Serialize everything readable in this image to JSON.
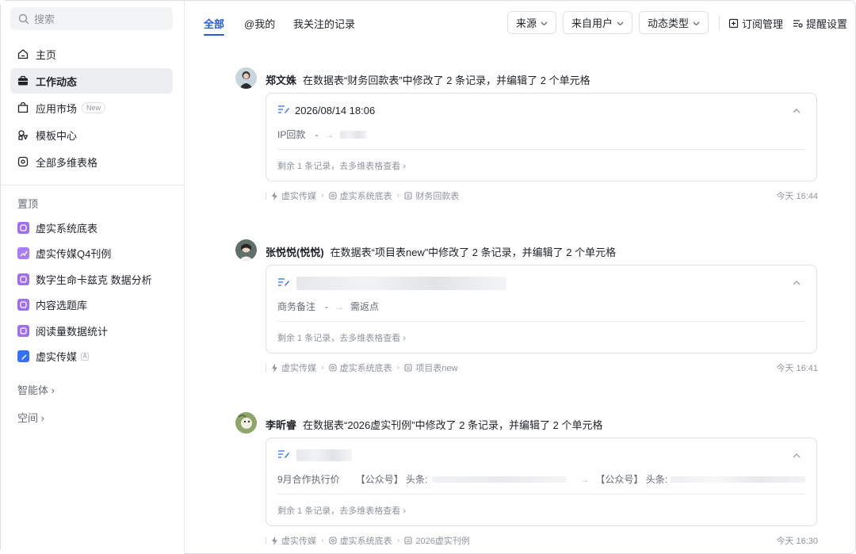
{
  "search": {
    "placeholder": "搜索"
  },
  "nav": [
    {
      "label": "主页",
      "icon": "home-icon"
    },
    {
      "label": "工作动态",
      "icon": "briefcase-icon",
      "active": true
    },
    {
      "label": "应用市场",
      "icon": "store-icon",
      "badge": "New"
    },
    {
      "label": "模板中心",
      "icon": "template-icon"
    },
    {
      "label": "全部多维表格",
      "icon": "base-icon"
    }
  ],
  "pinned": {
    "title": "置顶",
    "items": [
      {
        "label": "虚实系统底表",
        "color": "#9f6ff1"
      },
      {
        "label": "虚实传媒Q4刊例",
        "color": "#a97ef5"
      },
      {
        "label": "数字生命卡兹克 数据分析",
        "color": "#9f6ff1"
      },
      {
        "label": "内容选题库",
        "color": "#9f6ff1"
      },
      {
        "label": "阅读量数据统计",
        "color": "#9f6ff1"
      },
      {
        "label": "虚实传媒",
        "color": "#3370ff",
        "lock": "A"
      }
    ]
  },
  "agents": "智能体 ›",
  "space": "空间 ›",
  "tabs": [
    "全部",
    "@我的",
    "我关注的记录"
  ],
  "filters": {
    "source": "来源",
    "from_user": "来自用户",
    "type": "动态类型"
  },
  "tools": {
    "subscribe": "订阅管理",
    "remind": "提醒设置"
  },
  "accent": "#245bdb",
  "feed": [
    {
      "user": "郑文姝",
      "action": "在数据表“财务回款表”中修改了 2 条记录，并编辑了 2 个单元格",
      "record_title": "2026/08/14 18:06",
      "field": "IP回款",
      "old": "-",
      "new": "",
      "remain": "剩余 1 条记录，去多维表格查看 ›",
      "crumbs": [
        "虚实传媒",
        "虚实系统底表",
        "财务回款表"
      ],
      "time": "今天 16:44"
    },
    {
      "user": "张悦悦(悦悦)",
      "action": "在数据表“项目表new”中修改了 2 条记录，并编辑了 2 个单元格",
      "record_title": "",
      "field": "商务备注",
      "old": "-",
      "new": "需返点",
      "remain": "剩余 1 条记录，去多维表格查看 ›",
      "crumbs": [
        "虚实传媒",
        "虚实系统底表",
        "项目表new"
      ],
      "time": "今天 16:41"
    },
    {
      "user": "李昕睿",
      "action": "在数据表“2026虚实刊例”中修改了 2 条记录，并编辑了 2 个单元格",
      "record_title": "",
      "field": "9月合作执行价",
      "old": "【公众号】 头条:",
      "new": "【公众号】 头条:",
      "remain": "剩余 1 条记录，去多维表格查看 ›",
      "crumbs": [
        "虚实传媒",
        "虚实系统底表",
        "2026虚实刊例"
      ],
      "time": "今天 16:30"
    }
  ]
}
